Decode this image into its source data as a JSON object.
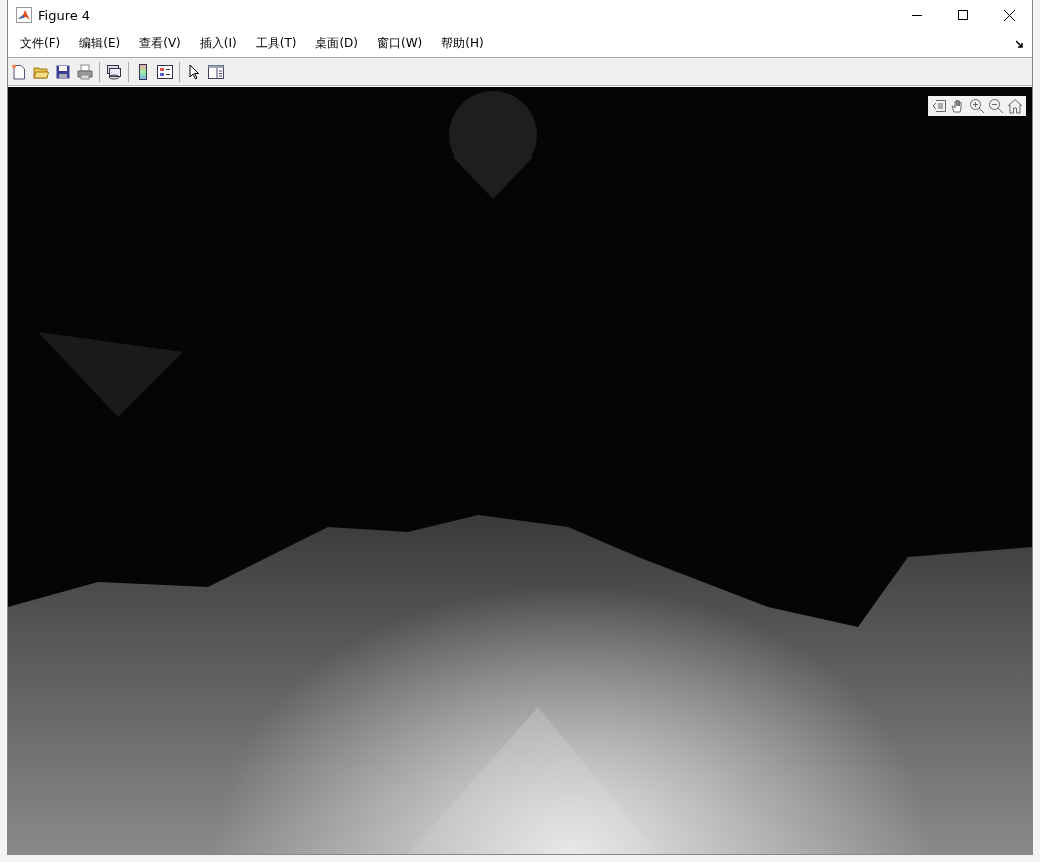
{
  "window": {
    "title": "Figure 4"
  },
  "menu": [
    "文件(F)",
    "编辑(E)",
    "查看(V)",
    "插入(I)",
    "工具(T)",
    "桌面(D)",
    "窗口(W)",
    "帮助(H)"
  ]
}
